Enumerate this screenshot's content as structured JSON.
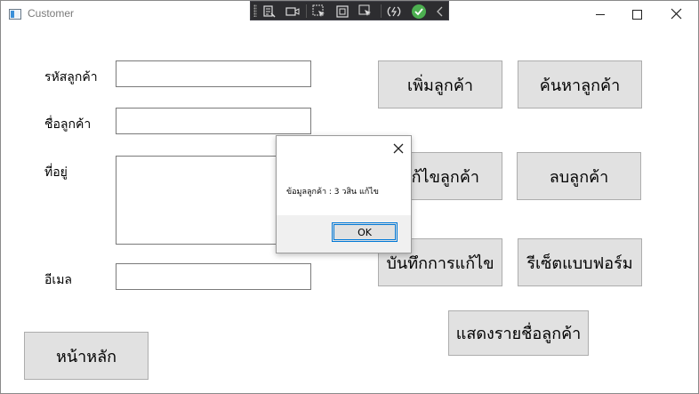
{
  "window": {
    "title": "Customer"
  },
  "form": {
    "customer_id_label": "รหัสลูกค้า",
    "customer_id_value": "",
    "customer_name_label": "ชื่อลูกค้า",
    "customer_name_value": "",
    "address_label": "ที่อยู่",
    "address_value": "",
    "email_label": "อีเมล",
    "email_value": ""
  },
  "buttons": {
    "add": "เพิ่มลูกค้า",
    "search": "ค้นหาลูกค้า",
    "edit": "แก้ไขลูกค้า",
    "delete": "ลบลูกค้า",
    "save_edit": "บันทึกการแก้ไข",
    "reset": "รีเซ็ตแบบฟอร์ม",
    "list": "แสดงรายชื่อลูกค้า",
    "home": "หน้าหลัก"
  },
  "dialog": {
    "message": "ข้อมูลลูกค้า : 3 วสิน แก้ไข",
    "ok_label": "OK"
  },
  "debug_toolbar": {
    "icons": [
      "live-visual-tree-icon",
      "camera-icon",
      "select-element-icon",
      "display-layout-adorners-icon",
      "track-focus-icon",
      "hot-reload-icon",
      "hot-reload-status-icon",
      "collapse-icon"
    ],
    "status_color": "#4caf50"
  }
}
